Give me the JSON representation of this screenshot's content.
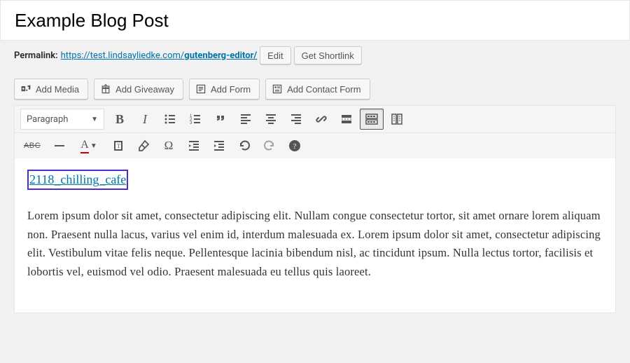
{
  "title": "Example Blog Post",
  "permalink": {
    "label": "Permalink:",
    "base": "https://test.lindsayliedke.com/",
    "slug": "gutenberg-editor/",
    "edit_label": "Edit",
    "shortlink_label": "Get Shortlink"
  },
  "media_buttons": {
    "add_media": "Add Media",
    "add_giveaway": "Add Giveaway",
    "add_form": "Add Form",
    "add_contact_form": "Add Contact Form"
  },
  "toolbar": {
    "format_select": "Paragraph",
    "bold": "B",
    "italic": "I",
    "text_color": "A",
    "abc": "ABC",
    "omega": "Ω"
  },
  "content": {
    "inserted_link_text": "2118_chilling_cafe",
    "paragraph": "Lorem ipsum dolor sit amet, consectetur adipiscing elit. Nullam congue consectetur tortor, sit amet ornare lorem aliquam non. Praesent nulla lacus, varius vel enim id, interdum malesuada ex. Lorem ipsum dolor sit amet, consectetur adipiscing elit. Vestibulum vitae felis neque. Pellentesque lacinia bibendum nisl, ac tincidunt ipsum. Nulla lectus tortor, facilisis et lobortis vel, euismod vel odio. Praesent malesuada eu tellus quis laoreet."
  }
}
